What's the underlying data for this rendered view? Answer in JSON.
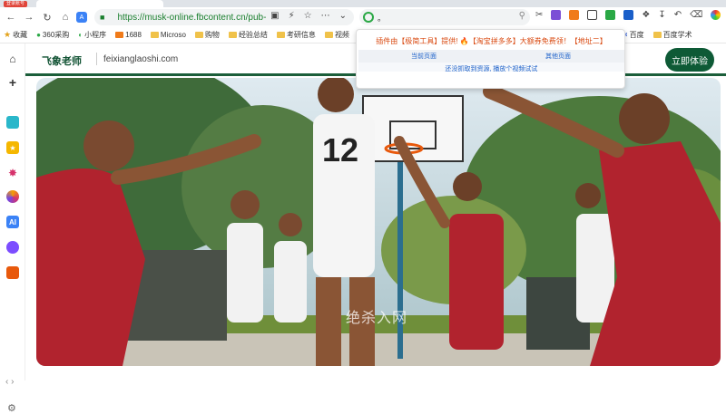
{
  "browser": {
    "badge": "登录账号",
    "url": "https://musk-online.fbcontent.cn/pub-",
    "search_value": "。",
    "bookmarks": [
      {
        "label": "收藏"
      },
      {
        "label": "360采购"
      },
      {
        "label": "小程序"
      },
      {
        "label": "1688"
      },
      {
        "label": "Microso"
      },
      {
        "label": "购物"
      },
      {
        "label": "经验总结"
      },
      {
        "label": "考研信息"
      },
      {
        "label": "视频"
      },
      {
        "label": "百度"
      },
      {
        "label": "百度学术"
      }
    ]
  },
  "site": {
    "logo": "飞象老师",
    "domain": "feixianglaoshi.com",
    "cta_label": "立即体验",
    "watermark": "绝杀入网",
    "jersey_number": "12"
  },
  "popup": {
    "title": "插件由【极简工具】提供! 🔥【淘宝拼多多】大额券免费领！【地址二】",
    "tab_current": "当前页面",
    "tab_other": "其他页面",
    "message": "还没抓取到资源, 播放个视频试试"
  },
  "colors": {
    "brand_green": "#0e5a36",
    "url_green": "#1a7f2e",
    "popup_orange": "#d9480f",
    "popup_blue": "#1a5fc9"
  }
}
